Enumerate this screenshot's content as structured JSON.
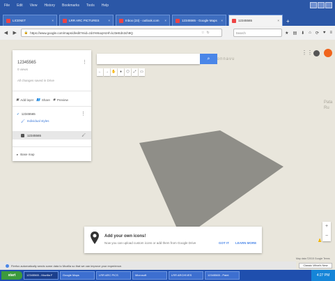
{
  "browser": {
    "menu_items": [
      "File",
      "Edit",
      "View",
      "History",
      "Bookmarks",
      "Tools",
      "Help"
    ],
    "tabs": [
      {
        "label": "LICENET"
      },
      {
        "label": "LRR ARC PICTURES"
      },
      {
        "label": "Inbox (23) - outlook.com"
      },
      {
        "label": "12345565 - Google Maps"
      },
      {
        "label": "12345565",
        "active": true
      }
    ],
    "new_tab": "+",
    "url": "https://www.google.com/maps/d/edit?mid=zd4Ye5oqHcHh.kJ3eEdn3ch9Q",
    "search_placeholder": "Search",
    "nav": {
      "back": "◀",
      "forward": "▶",
      "reload": "↻"
    }
  },
  "panel": {
    "title": "12345565",
    "views": "0 views",
    "saved": "All changes saved in Drive",
    "actions": [
      {
        "icon": "add-layer-icon",
        "label": "Add layer"
      },
      {
        "icon": "share-icon",
        "label": "Share"
      },
      {
        "icon": "preview-icon",
        "label": "Preview"
      }
    ],
    "layer": {
      "name": "12345565",
      "style": "Individual styles",
      "features": [
        {
          "name": "12345565"
        }
      ]
    },
    "base_map": "Base map"
  },
  "map": {
    "labels": [
      "Bolonnavu",
      "Pata Ru"
    ],
    "search_placeholder": "",
    "tools": [
      "←",
      "→",
      "✋",
      "♦",
      "⬡",
      "⤢",
      "▭"
    ],
    "polygon_color": "#8f8e88"
  },
  "promo": {
    "title": "Add your own icons!",
    "text": "Now you can upload custom icons or add them from Google Drive",
    "got_it": "GOT IT",
    "learn_more": "LEARN MORE"
  },
  "attribution": {
    "map_data": "Map data ©2015 Google  Terms",
    "classic_button": "Classic What's New"
  },
  "infobar": {
    "text": "Firefox automatically sends some data to Mozilla so that we can improve your experience."
  },
  "taskbar": {
    "start": "start",
    "tasks": [
      {
        "label": "12345565 - Mozilla F",
        "active": true
      },
      {
        "label": "Google Maps"
      },
      {
        "label": "LRR ARC PICS"
      },
      {
        "label": "Microsoft"
      },
      {
        "label": "LRR ARCHIVES"
      },
      {
        "label": "12345565 - Paint"
      }
    ],
    "clock": "4:27 PM"
  }
}
